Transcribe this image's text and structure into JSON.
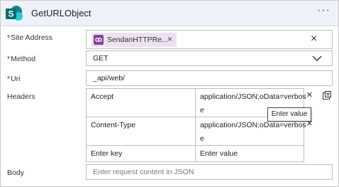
{
  "header": {
    "title": "GetURLObject",
    "more_label": "···",
    "background": "#eef2f8"
  },
  "site_address": {
    "label": "Site Address",
    "required_marker": "*",
    "token_label": "SendanHTTPRe...",
    "token_close": "×",
    "clear": "×"
  },
  "method": {
    "label": "Method",
    "required_marker": "*",
    "value": "GET"
  },
  "uri": {
    "label": "Uri",
    "required_marker": "*",
    "value": "_api/web/"
  },
  "headers": {
    "label": "Headers",
    "rows": [
      {
        "key": "Accept",
        "value_line1": "application/JSON;oData=verbos",
        "value_line2": "e"
      },
      {
        "key": "Content-Type",
        "value_line1": "application/JSON;oData=verbos",
        "value_line2": "e"
      }
    ],
    "new_key_placeholder": "Enter key",
    "new_value_placeholder": "Enter value",
    "remove": "×",
    "tooltip": "Enter value"
  },
  "body": {
    "label": "Body",
    "placeholder": "Enter request content in JSON"
  },
  "colors": {
    "required": "#cc0000",
    "accent": "#0a61c9",
    "token_bg": "#ece1f1",
    "token_icon": "#8a3f9e",
    "sharepoint": "#036c70"
  }
}
